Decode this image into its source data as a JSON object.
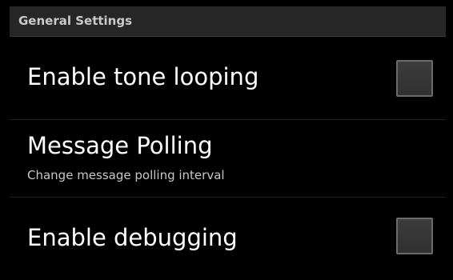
{
  "header": {
    "title": "General Settings"
  },
  "preferences": [
    {
      "title": "Enable tone looping",
      "type": "checkbox",
      "checked": false
    },
    {
      "title": "Message Polling",
      "summary": "Change message polling interval",
      "type": "action"
    },
    {
      "title": "Enable debugging",
      "type": "checkbox",
      "checked": false
    }
  ],
  "colors": {
    "background": "#000000",
    "header_background": "#262626",
    "header_text": "#c9c9c9",
    "title_text": "#ffffff",
    "summary_text": "#c8c8c8",
    "checkbox_border": "#6a6a6a"
  }
}
